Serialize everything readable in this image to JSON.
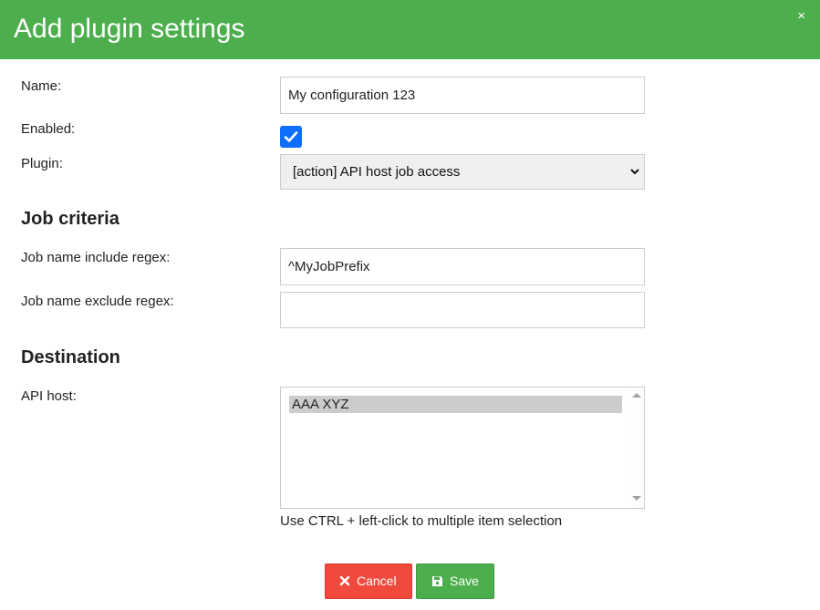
{
  "dialog": {
    "title": "Add plugin settings",
    "close_label": "×"
  },
  "form": {
    "name_label": "Name:",
    "name_value": "My configuration 123",
    "enabled_label": "Enabled:",
    "enabled_checked": true,
    "plugin_label": "Plugin:",
    "plugin_selected": "[action] API host job access"
  },
  "job_criteria": {
    "heading": "Job criteria",
    "include_label": "Job name include regex:",
    "include_value": "^MyJobPrefix",
    "exclude_label": "Job name exclude regex:",
    "exclude_value": ""
  },
  "destination": {
    "heading": "Destination",
    "api_host_label": "API host:",
    "api_host_options": [
      "AAA XYZ"
    ],
    "hint": "Use CTRL + left-click to multiple item selection"
  },
  "buttons": {
    "cancel_label": "Cancel",
    "save_label": "Save"
  },
  "colors": {
    "header": "#4cae4c",
    "cancel": "#f04a3e",
    "save": "#4cae4c",
    "checkbox": "#0d6efd"
  }
}
